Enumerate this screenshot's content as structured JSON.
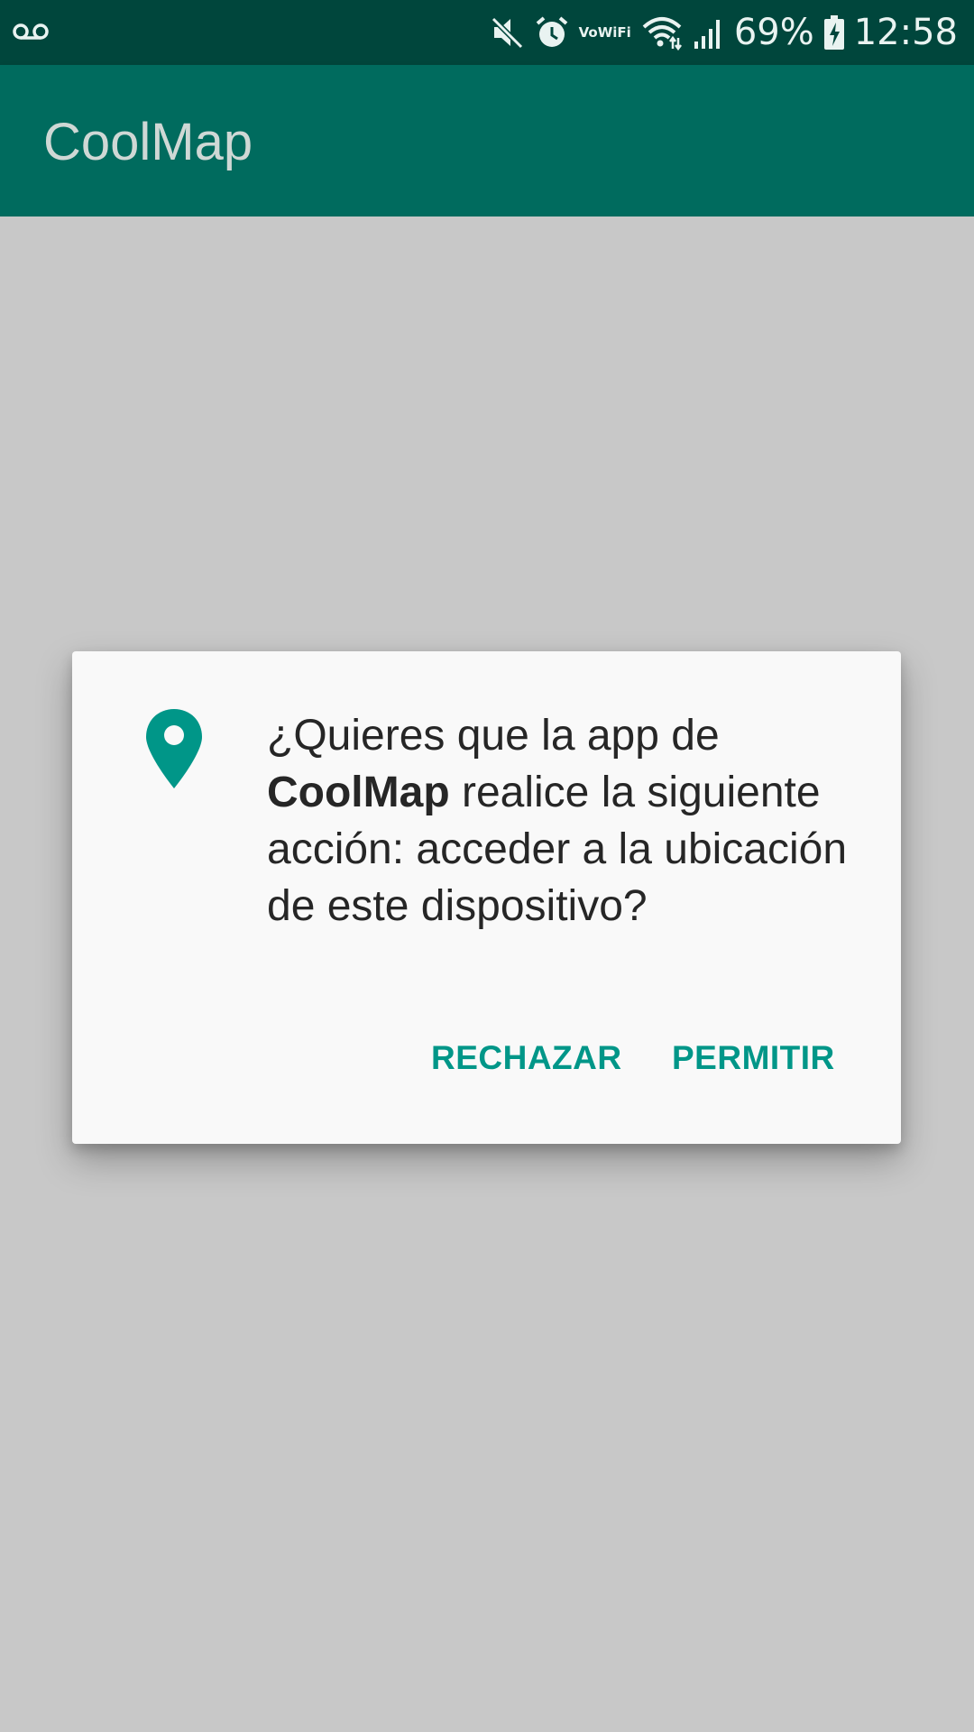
{
  "status_bar": {
    "battery_percent": "69%",
    "time": "12:58",
    "vowifi_top": "Vo",
    "vowifi_bottom": "WiFi",
    "icons": [
      "voicemail-icon",
      "mute-icon",
      "alarm-icon",
      "vowifi-icon",
      "wifi-icon",
      "signal-icon",
      "battery-charging-icon"
    ]
  },
  "app_bar": {
    "title": "CoolMap"
  },
  "dialog": {
    "icon": "location-pin-icon",
    "message_prefix": "¿Quieres que la app de ",
    "message_app_name": "CoolMap",
    "message_suffix": " realice la siguiente acción: acceder a la ubicación de este dispositivo?",
    "deny_label": "RECHAZAR",
    "allow_label": "PERMITIR"
  },
  "colors": {
    "status_bar": "#00463c",
    "app_bar": "#006b5e",
    "accent": "#009688",
    "background": "#c8c8c8",
    "dialog": "#f9f9f9"
  }
}
